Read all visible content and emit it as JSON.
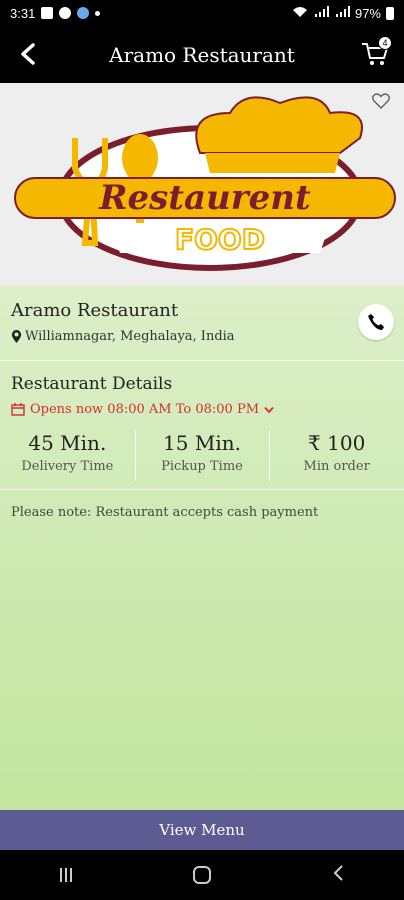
{
  "status_bar": {
    "time": "3:31",
    "battery": "97%"
  },
  "app_bar": {
    "title": "Aramo Restaurant",
    "cart_count": "4"
  },
  "banner": {
    "logo_word1": "Restaurent",
    "logo_word2": "FOOD"
  },
  "restaurant": {
    "name": "Aramo Restaurant",
    "address": "Williamnagar, Meghalaya, India",
    "details_title": "Restaurant Details",
    "hours": "Opens now 08:00 AM To 08:00 PM",
    "stats": [
      {
        "value": "45 Min.",
        "label": "Delivery Time"
      },
      {
        "value": "15 Min.",
        "label": "Pickup Time"
      },
      {
        "value": "₹ 100",
        "label": "Min order"
      }
    ],
    "note": "Please note: Restaurant accepts cash payment"
  },
  "footer": {
    "view_menu": "View Menu"
  },
  "colors": {
    "accent": "#5c5c93",
    "hours": "#d32f2f",
    "logo_yellow": "#f5b700",
    "logo_maroon": "#7a1e2e"
  }
}
